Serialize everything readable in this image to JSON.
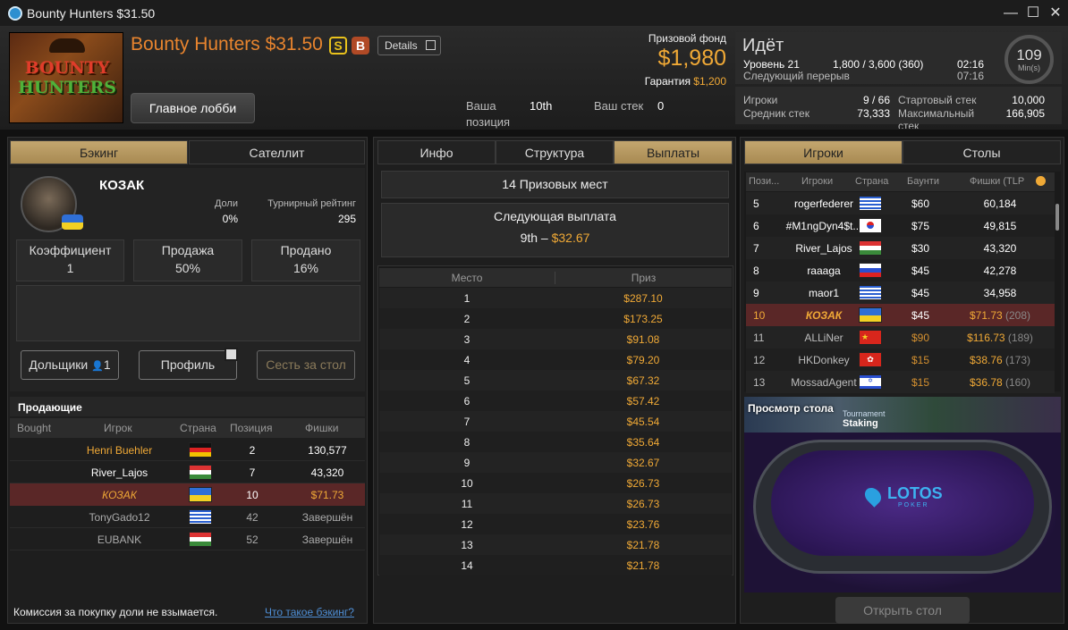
{
  "window": {
    "title": "Bounty Hunters $31.50",
    "minimize": "—",
    "maximize": "☐",
    "close": "✕"
  },
  "header": {
    "thumb_line1": "BOUNTY",
    "thumb_line2": "HUNTERS",
    "name": "Bounty Hunters $31.50",
    "badge_s": "S",
    "badge_b": "B",
    "details_label": "Details",
    "lobby_button": "Главное лобби",
    "position_label_1": "Ваша",
    "position_label_2": "позиция",
    "position_value": "10th",
    "stack_label": "Ваш стек",
    "stack_value": "0",
    "prize_label": "Призовой фонд",
    "prize_value": "$1,980",
    "guarantee_label": "Гарантия",
    "guarantee_value": "$1,200"
  },
  "status": {
    "state": "Идёт",
    "level_label": "Уровень 21",
    "blinds": "1,800 / 3,600 (360)",
    "level_time": "02:16",
    "break_label": "Следующий перерыв",
    "break_time": "07:16",
    "clock_value": "109",
    "clock_unit": "Min(s)",
    "players_label": "Игроки",
    "players_value": "9 / 66",
    "avg_label": "Средник стек",
    "avg_value": "73,333",
    "start_label": "Стартовый стек",
    "start_value": "10,000",
    "max_label_1": "Максимальный",
    "max_label_2": "стек",
    "max_value": "166,905"
  },
  "left": {
    "tab_backing": "Бэкинг",
    "tab_satellite": "Сателлит",
    "player_name": "КОЗАК",
    "shares_label": "Доли",
    "shares_value": "0%",
    "rating_label": "Турнирный рейтинг",
    "rating_value": "295",
    "coef_label": "Коэффициент",
    "coef_value": "1",
    "sale_label": "Продажа",
    "sale_value": "50%",
    "sold_label": "Продано",
    "sold_value": "16%",
    "shareholders_btn": "Дольщики",
    "shareholders_count": "1",
    "profile_btn": "Профиль",
    "sit_btn": "Сесть за стол",
    "sellers_title": "Продающие",
    "col_bought": "Bought",
    "col_player": "Игрок",
    "col_country": "Страна",
    "col_position": "Позиция",
    "col_chips": "Фишки",
    "sellers": [
      {
        "name": "Henri Buehler",
        "pos": "2",
        "chips": "130,577",
        "flag": "de"
      },
      {
        "name": "River_Lajos",
        "pos": "7",
        "chips": "43,320",
        "flag": "hu"
      },
      {
        "name": "КОЗАК",
        "pos": "10",
        "chips": "$71.73",
        "flag": "ua"
      },
      {
        "name": "TonyGado12",
        "pos": "42",
        "chips": "Завершён",
        "flag": "gr"
      },
      {
        "name": "EUBANK",
        "pos": "52",
        "chips": "Завершён",
        "flag": "hu"
      }
    ],
    "footer_note": "Комиссия за покупку доли не взымается.",
    "footer_link": "Что такое бэкинг?"
  },
  "middle": {
    "tab_info": "Инфо",
    "tab_structure": "Структура",
    "tab_payouts": "Выплаты",
    "prize_places": "14 Призовых мест",
    "next_payout_label": "Следующая выплата",
    "next_payout_place": "9th –",
    "next_payout_value": "$32.67",
    "col_place": "Место",
    "col_prize": "Приз",
    "payouts": [
      {
        "p": "1",
        "v": "$287.10"
      },
      {
        "p": "2",
        "v": "$173.25"
      },
      {
        "p": "3",
        "v": "$91.08"
      },
      {
        "p": "4",
        "v": "$79.20"
      },
      {
        "p": "5",
        "v": "$67.32"
      },
      {
        "p": "6",
        "v": "$57.42"
      },
      {
        "p": "7",
        "v": "$45.54"
      },
      {
        "p": "8",
        "v": "$35.64"
      },
      {
        "p": "9",
        "v": "$32.67"
      },
      {
        "p": "10",
        "v": "$26.73"
      },
      {
        "p": "11",
        "v": "$26.73"
      },
      {
        "p": "12",
        "v": "$23.76"
      },
      {
        "p": "13",
        "v": "$21.78"
      },
      {
        "p": "14",
        "v": "$21.78"
      }
    ]
  },
  "right": {
    "tab_players": "Игроки",
    "tab_tables": "Столы",
    "col_pos": "Пози...",
    "col_player": "Игроки",
    "col_country": "Страна",
    "col_bounty": "Баунти",
    "col_chips": "Фишки (TLP",
    "players": [
      {
        "pos": "5",
        "name": "rogerfederer",
        "flag": "gr",
        "bounty": "$60",
        "chips": "60,184",
        "extra": ""
      },
      {
        "pos": "6",
        "name": "#M1ngDyn4$t...",
        "flag": "kr",
        "bounty": "$75",
        "chips": "49,815",
        "extra": ""
      },
      {
        "pos": "7",
        "name": "River_Lajos",
        "flag": "hu",
        "bounty": "$30",
        "chips": "43,320",
        "extra": ""
      },
      {
        "pos": "8",
        "name": "raaaga",
        "flag": "ru",
        "bounty": "$45",
        "chips": "42,278",
        "extra": ""
      },
      {
        "pos": "9",
        "name": "maor1",
        "flag": "gr",
        "bounty": "$45",
        "chips": "34,958",
        "extra": ""
      },
      {
        "pos": "10",
        "name": "КОЗАК",
        "flag": "ua",
        "bounty": "$45",
        "chips": "$71.73",
        "extra": "(208)"
      },
      {
        "pos": "11",
        "name": "ALLiNer",
        "flag": "cn",
        "bounty": "$90",
        "chips": "$116.73",
        "extra": "(189)"
      },
      {
        "pos": "12",
        "name": "HKDonkey",
        "flag": "hk",
        "bounty": "$15",
        "chips": "$38.76",
        "extra": "(173)"
      },
      {
        "pos": "13",
        "name": "MossadAgent",
        "flag": "il",
        "bounty": "$15",
        "chips": "$36.78",
        "extra": "(160)"
      }
    ],
    "preview_label": "Просмотр стола",
    "preview_banner_1": "Tournament",
    "preview_banner_2": "Staking",
    "logo_text": "LOTOS",
    "logo_sub": "POKER",
    "open_table_btn": "Открыть стол"
  }
}
